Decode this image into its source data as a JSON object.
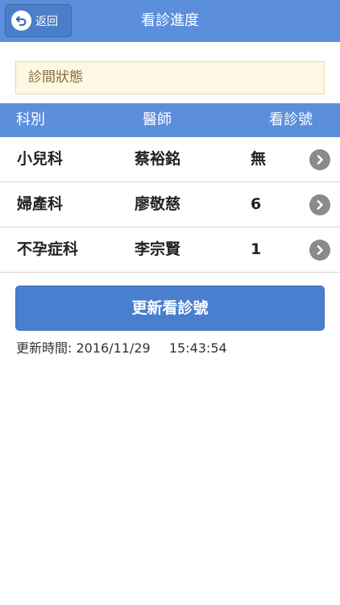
{
  "header": {
    "back_label": "返回",
    "title": "看診進度"
  },
  "status": {
    "label": "診間狀態"
  },
  "table": {
    "columns": [
      "科別",
      "醫師",
      "看診號"
    ],
    "rows": [
      {
        "department": "小兒科",
        "doctor": "蔡裕銘",
        "number": "無"
      },
      {
        "department": "婦產科",
        "doctor": "廖敬慈",
        "number": "6"
      },
      {
        "department": "不孕症科",
        "doctor": "李宗賢",
        "number": "1"
      }
    ]
  },
  "refresh": {
    "label": "更新看診號"
  },
  "updated": {
    "label": "更新時間:",
    "date": "2016/11/29",
    "time": "15:43:54"
  },
  "colors": {
    "header_bg": "#5b8fdc",
    "button_bg": "#4a7fcf",
    "status_bg": "#fcf8e3",
    "status_text": "#8a6d3b"
  },
  "icons": {
    "back": "back-arrow-icon",
    "row_chevron": "chevron-right-circle-icon"
  }
}
